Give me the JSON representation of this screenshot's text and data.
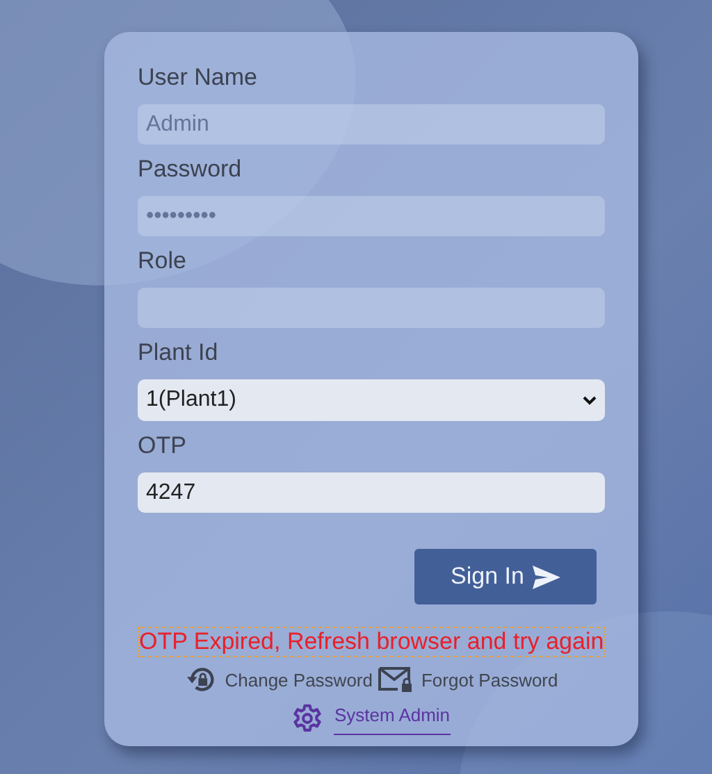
{
  "form": {
    "fields": [
      {
        "label": "User Name",
        "kind": "text",
        "placeholder": "Admin"
      },
      {
        "label": "Password",
        "kind": "password",
        "placeholder": "•••••••••"
      },
      {
        "label": "Role",
        "kind": "text"
      },
      {
        "label": "Plant Id",
        "kind": "select",
        "value": "1(Plant1)"
      },
      {
        "label": "OTP",
        "kind": "text",
        "value": "4247"
      }
    ],
    "submit": {
      "label": "Sign In"
    },
    "error": "OTP Expired, Refresh browser and try again",
    "links": [
      {
        "label": "Change Password",
        "kind": "change-password"
      },
      {
        "label": "Forgot Password",
        "kind": "forgot-password"
      }
    ],
    "admin_link": {
      "label": "System Admin",
      "kind": "settings"
    }
  }
}
